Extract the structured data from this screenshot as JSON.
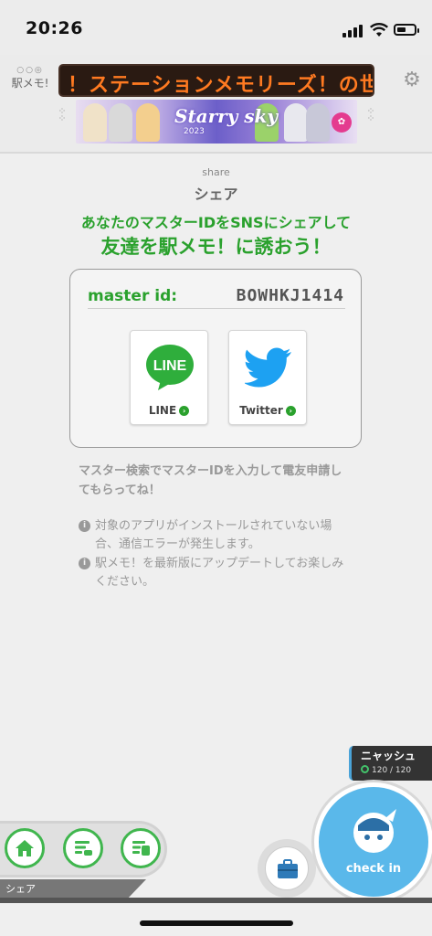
{
  "status_bar": {
    "time": "20:26"
  },
  "header": {
    "logo_text": "駅メモ!",
    "ticker_text": "！ステーションメモリーズ！の世",
    "banner": {
      "title": "Starry sky",
      "subtitle": "2023"
    }
  },
  "page": {
    "title_en": "share",
    "title_jp": "シェア",
    "lead_line1": "あなたのマスターIDをSNSにシェアして",
    "lead_line2": "友達を駅メモ！に誘おう！"
  },
  "master": {
    "label": "master id:",
    "value": "BOWHKJ1414"
  },
  "share_buttons": [
    {
      "label": "LINE",
      "logo_text": "LINE"
    },
    {
      "label": "Twitter"
    }
  ],
  "note": "マスター検索でマスターIDを入力して電友申請してもらってね！",
  "info": [
    "対象のアプリがインストールされていない場合、通信エラーが発生します。",
    "駅メモ！を最新版にアップデートしてお楽しみください。"
  ],
  "player": {
    "name": "ニャッシュ",
    "hp": "120 / 120"
  },
  "nav": {
    "current_label": "シェア"
  },
  "checkin": {
    "label": "check in"
  },
  "colors": {
    "accent_green": "#2aa12d",
    "checkin_blue": "#5ab8ea",
    "ticker_orange": "#ff7a21"
  }
}
